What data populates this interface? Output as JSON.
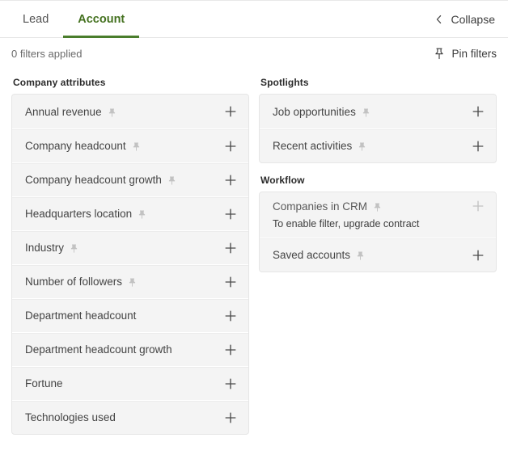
{
  "tabs": [
    {
      "label": "Lead",
      "active": false
    },
    {
      "label": "Account",
      "active": true
    }
  ],
  "header": {
    "collapse_label": "Collapse",
    "collapse_icon": "chevron-left-icon"
  },
  "filter_bar": {
    "filters_applied_text": "0 filters applied",
    "pin_filters_label": "Pin filters",
    "pin_filters_icon": "pin-icon"
  },
  "colors": {
    "accent_green": "#4a7d2c",
    "active_tab_text": "#44711f",
    "row_background": "#f4f4f4",
    "card_border": "#e6e6e6",
    "label_text": "#444444",
    "disabled_icon": "#c2c2c2"
  },
  "left_column": {
    "sections": [
      {
        "title": "Company attributes",
        "rows": [
          {
            "label": "Annual revenue",
            "pinned_icon": true,
            "disabled": false,
            "add_icon": "plus-icon"
          },
          {
            "label": "Company headcount",
            "pinned_icon": true,
            "disabled": false,
            "add_icon": "plus-icon"
          },
          {
            "label": "Company headcount growth",
            "pinned_icon": true,
            "disabled": false,
            "add_icon": "plus-icon"
          },
          {
            "label": "Headquarters location",
            "pinned_icon": true,
            "disabled": false,
            "add_icon": "plus-icon"
          },
          {
            "label": "Industry",
            "pinned_icon": true,
            "disabled": false,
            "add_icon": "plus-icon"
          },
          {
            "label": "Number of followers",
            "pinned_icon": true,
            "disabled": false,
            "add_icon": "plus-icon"
          },
          {
            "label": "Department headcount",
            "pinned_icon": false,
            "disabled": false,
            "add_icon": "plus-icon"
          },
          {
            "label": "Department headcount growth",
            "pinned_icon": false,
            "disabled": false,
            "add_icon": "plus-icon"
          },
          {
            "label": "Fortune",
            "pinned_icon": false,
            "disabled": false,
            "add_icon": "plus-icon"
          },
          {
            "label": "Technologies used",
            "pinned_icon": false,
            "disabled": false,
            "add_icon": "plus-icon"
          }
        ]
      }
    ]
  },
  "right_column": {
    "sections": [
      {
        "title": "Spotlights",
        "rows": [
          {
            "label": "Job opportunities",
            "pinned_icon": true,
            "disabled": false,
            "add_icon": "plus-icon"
          },
          {
            "label": "Recent activities",
            "pinned_icon": true,
            "disabled": false,
            "add_icon": "plus-icon"
          }
        ]
      },
      {
        "title": "Workflow",
        "rows": [
          {
            "label": "Companies in CRM",
            "pinned_icon": true,
            "disabled": true,
            "add_icon": "plus-icon",
            "sub_label": "To enable filter, upgrade contract"
          },
          {
            "label": "Saved accounts",
            "pinned_icon": true,
            "disabled": false,
            "add_icon": "plus-icon"
          }
        ]
      }
    ]
  }
}
